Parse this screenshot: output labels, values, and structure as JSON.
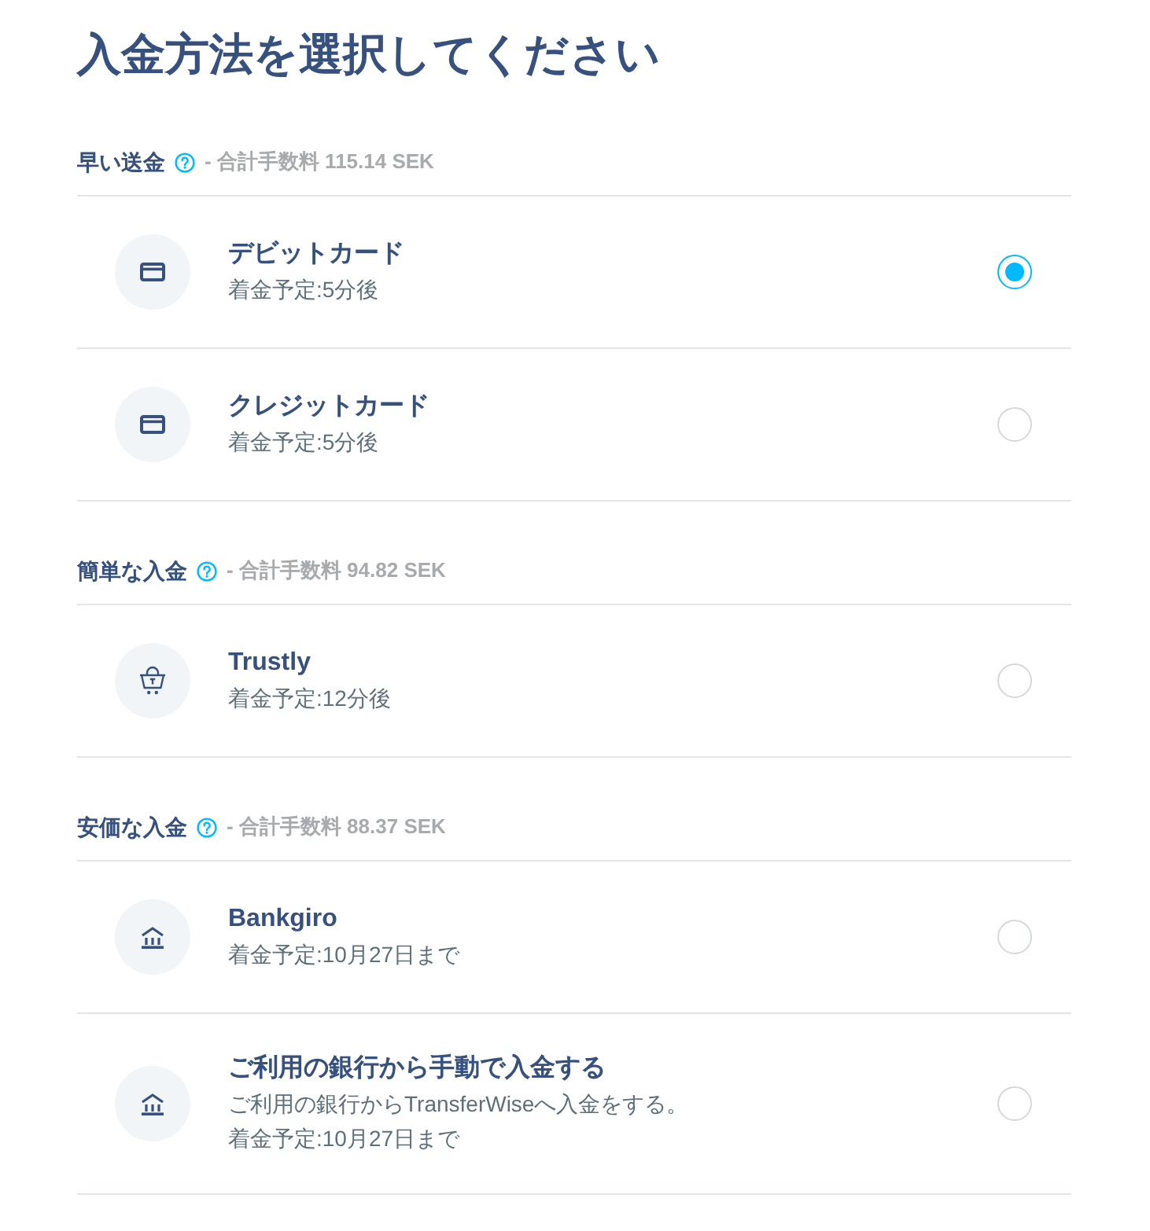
{
  "title": "入金方法を選択してください",
  "sections": [
    {
      "label": "早い送金",
      "fee": "- 合計手数料 115.14 SEK",
      "methods": [
        {
          "kind": "card",
          "name": "デビットカード",
          "details": [
            "着金予定:5分後"
          ],
          "selected": true
        },
        {
          "kind": "card",
          "name": "クレジットカード",
          "details": [
            "着金予定:5分後"
          ],
          "selected": false
        }
      ]
    },
    {
      "label": "簡単な入金",
      "fee": "- 合計手数料 94.82 SEK",
      "methods": [
        {
          "kind": "basket",
          "name": "Trustly",
          "details": [
            "着金予定:12分後"
          ],
          "selected": false
        }
      ]
    },
    {
      "label": "安価な入金",
      "fee": "- 合計手数料 88.37 SEK",
      "methods": [
        {
          "kind": "bank",
          "name": "Bankgiro",
          "details": [
            "着金予定:10月27日まで"
          ],
          "selected": false
        },
        {
          "kind": "bank",
          "name": "ご利用の銀行から手動で入金する",
          "details": [
            "ご利用の銀行からTransferWiseへ入金をする。",
            "着金予定:10月27日まで"
          ],
          "selected": false
        }
      ]
    }
  ]
}
